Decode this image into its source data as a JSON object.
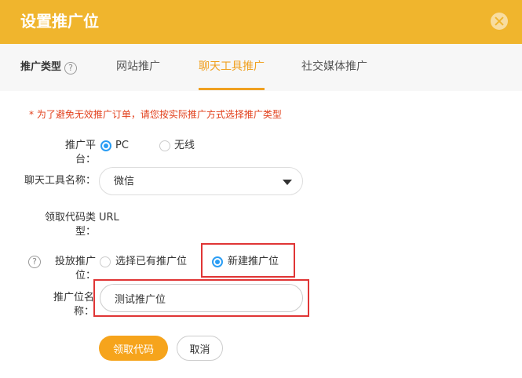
{
  "dialog": {
    "title": "设置推广位",
    "close_icon": "close-circle-icon"
  },
  "tabs": {
    "type_label": "推广类型",
    "help_glyph": "?",
    "items": [
      {
        "label": "网站推广",
        "active": false
      },
      {
        "label": "聊天工具推广",
        "active": true
      },
      {
        "label": "社交媒体推广",
        "active": false
      }
    ]
  },
  "form": {
    "warning": "*  为了避免无效推广订单，请您按实际推广方式选择推广类型",
    "platform": {
      "label": "推广平台：",
      "options": [
        {
          "label": "PC",
          "selected": true
        },
        {
          "label": "无线",
          "selected": false
        }
      ]
    },
    "chat_tool": {
      "label": "聊天工具名称：",
      "value": "微信"
    },
    "code_type": {
      "label": "领取代码类型：",
      "value": "URL"
    },
    "placement": {
      "help_glyph": "?",
      "label": "投放推广位：",
      "options": [
        {
          "label": "选择已有推广位",
          "selected": false
        },
        {
          "label": "新建推广位",
          "selected": true
        }
      ]
    },
    "placement_name": {
      "label": "推广位名称：",
      "value": "测试推广位"
    }
  },
  "actions": {
    "get_code": "领取代码",
    "cancel": "取消"
  },
  "colors": {
    "header": "#f0b52d",
    "accent": "#f0a020",
    "radio": "#2a9df4",
    "highlight_box": "#e03535",
    "warning": "#e2401c"
  }
}
